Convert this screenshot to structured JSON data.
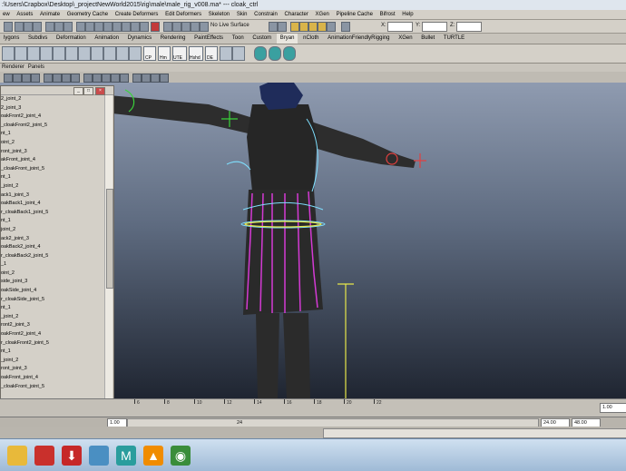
{
  "title_bar": {
    "text": ":\\Users\\Crapbox\\Desktop\\_projectNewWorld2015\\rig\\male\\male_rig_v008.ma*   ---   cloak_ctrl"
  },
  "menu_bar": {
    "items": [
      "ew",
      "Assets",
      "Animate",
      "Geometry Cache",
      "Create Deformers",
      "Edit Deformers",
      "Skeleton",
      "Skin",
      "Constrain",
      "Character",
      "XGen",
      "Pipeline Cache",
      "Bifrost",
      "Help"
    ]
  },
  "status_line": {
    "live_surface": "No Live Surface",
    "coord_labels": [
      "X:",
      "Y:",
      "Z:"
    ]
  },
  "shelf_tabs": {
    "items": [
      "lygons",
      "Subdivs",
      "Deformation",
      "Animation",
      "Dynamics",
      "Rendering",
      "PaintEffects",
      "Toon",
      "Custom",
      "Bryan",
      "nCloth",
      "AnimationFriendlyRigging",
      "XGen",
      "Bullet",
      "TURTLE"
    ],
    "active": "Bryan"
  },
  "shelf_buttons": {
    "labels": [
      "CP",
      "Hm",
      "UTE",
      "Hshd",
      "DE"
    ]
  },
  "panel_menu": {
    "items": [
      "Renderer",
      "Panels"
    ]
  },
  "outliner": {
    "rows": [
      "2_joint_2",
      "2_joint_3",
      "oakFront2_joint_4",
      "_cloakFront2_joint_5",
      "nt_1",
      "oint_2",
      "ront_joint_3",
      "akFront_joint_4",
      "_cloakFront_joint_5",
      "nt_1",
      "_joint_2",
      "ack1_joint_3",
      "oakBack1_joint_4",
      "r_cloakBack1_joint_5",
      "nt_1",
      "joint_2",
      "ack2_joint_3",
      "oakBack2_joint_4",
      "r_cloakBack2_joint_5",
      "_1",
      "oint_2",
      "side_joint_3",
      "oakSide_joint_4",
      "r_cloakSide_joint_5",
      "nt_1",
      "_joint_2",
      "ront2_joint_3",
      "oakFront2_joint_4",
      "r_cloakFront2_joint_5",
      "nt_1",
      "_joint_2",
      "ront_joint_3",
      "oakFront_joint_4",
      "_cloakFront_joint_5"
    ],
    "scroll_fraction": 0.4
  },
  "time_slider": {
    "ticks": [
      "6",
      "8",
      "10",
      "12",
      "14",
      "16",
      "18",
      "20",
      "22"
    ],
    "end_field": "1.00"
  },
  "range_slider": {
    "start_field": "1.00",
    "current": "24",
    "end_field_1": "24.00",
    "end_field_2": "48.00"
  },
  "taskbar": {
    "buttons": [
      {
        "icon": "windows-explorer-icon",
        "color": "#e8b93a",
        "glyph": ""
      },
      {
        "icon": "pdf-icon",
        "color": "#c9302c",
        "glyph": ""
      },
      {
        "icon": "download-icon",
        "color": "#c62828",
        "glyph": "⬇"
      },
      {
        "icon": "network-icon",
        "color": "#4a8fc2",
        "glyph": ""
      },
      {
        "icon": "maya-icon",
        "color": "#2a9d9d",
        "glyph": "M"
      },
      {
        "icon": "vlc-icon",
        "color": "#f08c00",
        "glyph": "▲"
      },
      {
        "icon": "chrome-icon",
        "color": "#3a8d3a",
        "glyph": "◉"
      }
    ]
  },
  "colors": {
    "cloak_joints": "#d43ad4",
    "control_curve": "#7fe0ff",
    "handle_yellow": "#e6e64a",
    "character": "#2a2a2a"
  }
}
